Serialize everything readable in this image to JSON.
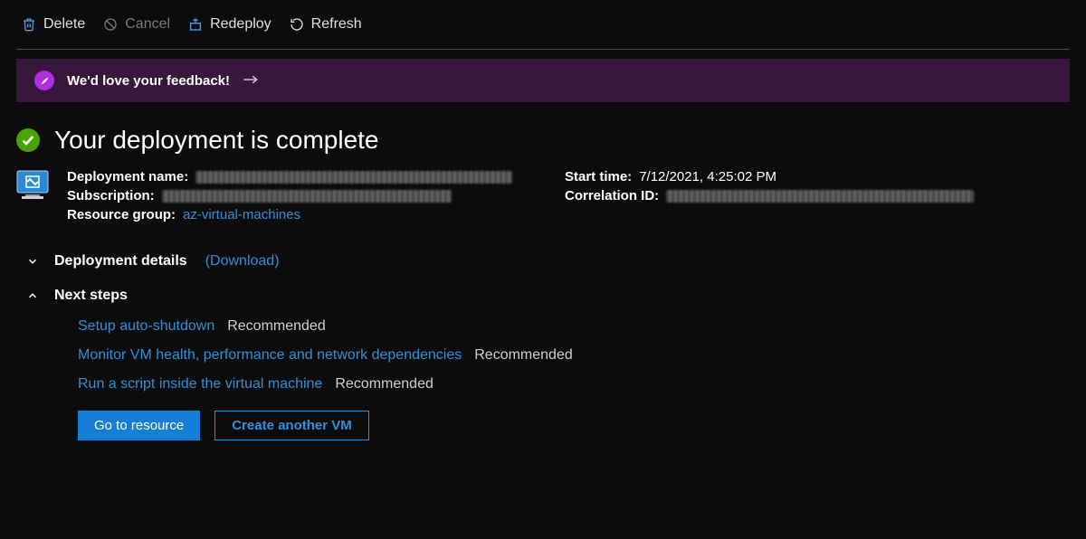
{
  "toolbar": {
    "delete": "Delete",
    "cancel": "Cancel",
    "redeploy": "Redeploy",
    "refresh": "Refresh"
  },
  "feedback": {
    "text": "We'd love your feedback!"
  },
  "heading": "Your deployment is complete",
  "summary": {
    "labels": {
      "deployment_name": "Deployment name:",
      "subscription": "Subscription:",
      "resource_group": "Resource group:",
      "start_time": "Start time:",
      "correlation_id": "Correlation ID:"
    },
    "resource_group_value": "az-virtual-machines",
    "start_time_value": "7/12/2021, 4:25:02 PM"
  },
  "expanders": {
    "deployment_details": "Deployment details",
    "download": "(Download)",
    "next_steps": "Next steps"
  },
  "steps": [
    {
      "link": "Setup auto-shutdown",
      "badge": "Recommended"
    },
    {
      "link": "Monitor VM health, performance and network dependencies",
      "badge": "Recommended"
    },
    {
      "link": "Run a script inside the virtual machine",
      "badge": "Recommended"
    }
  ],
  "buttons": {
    "go_to_resource": "Go to resource",
    "create_another": "Create another VM"
  }
}
